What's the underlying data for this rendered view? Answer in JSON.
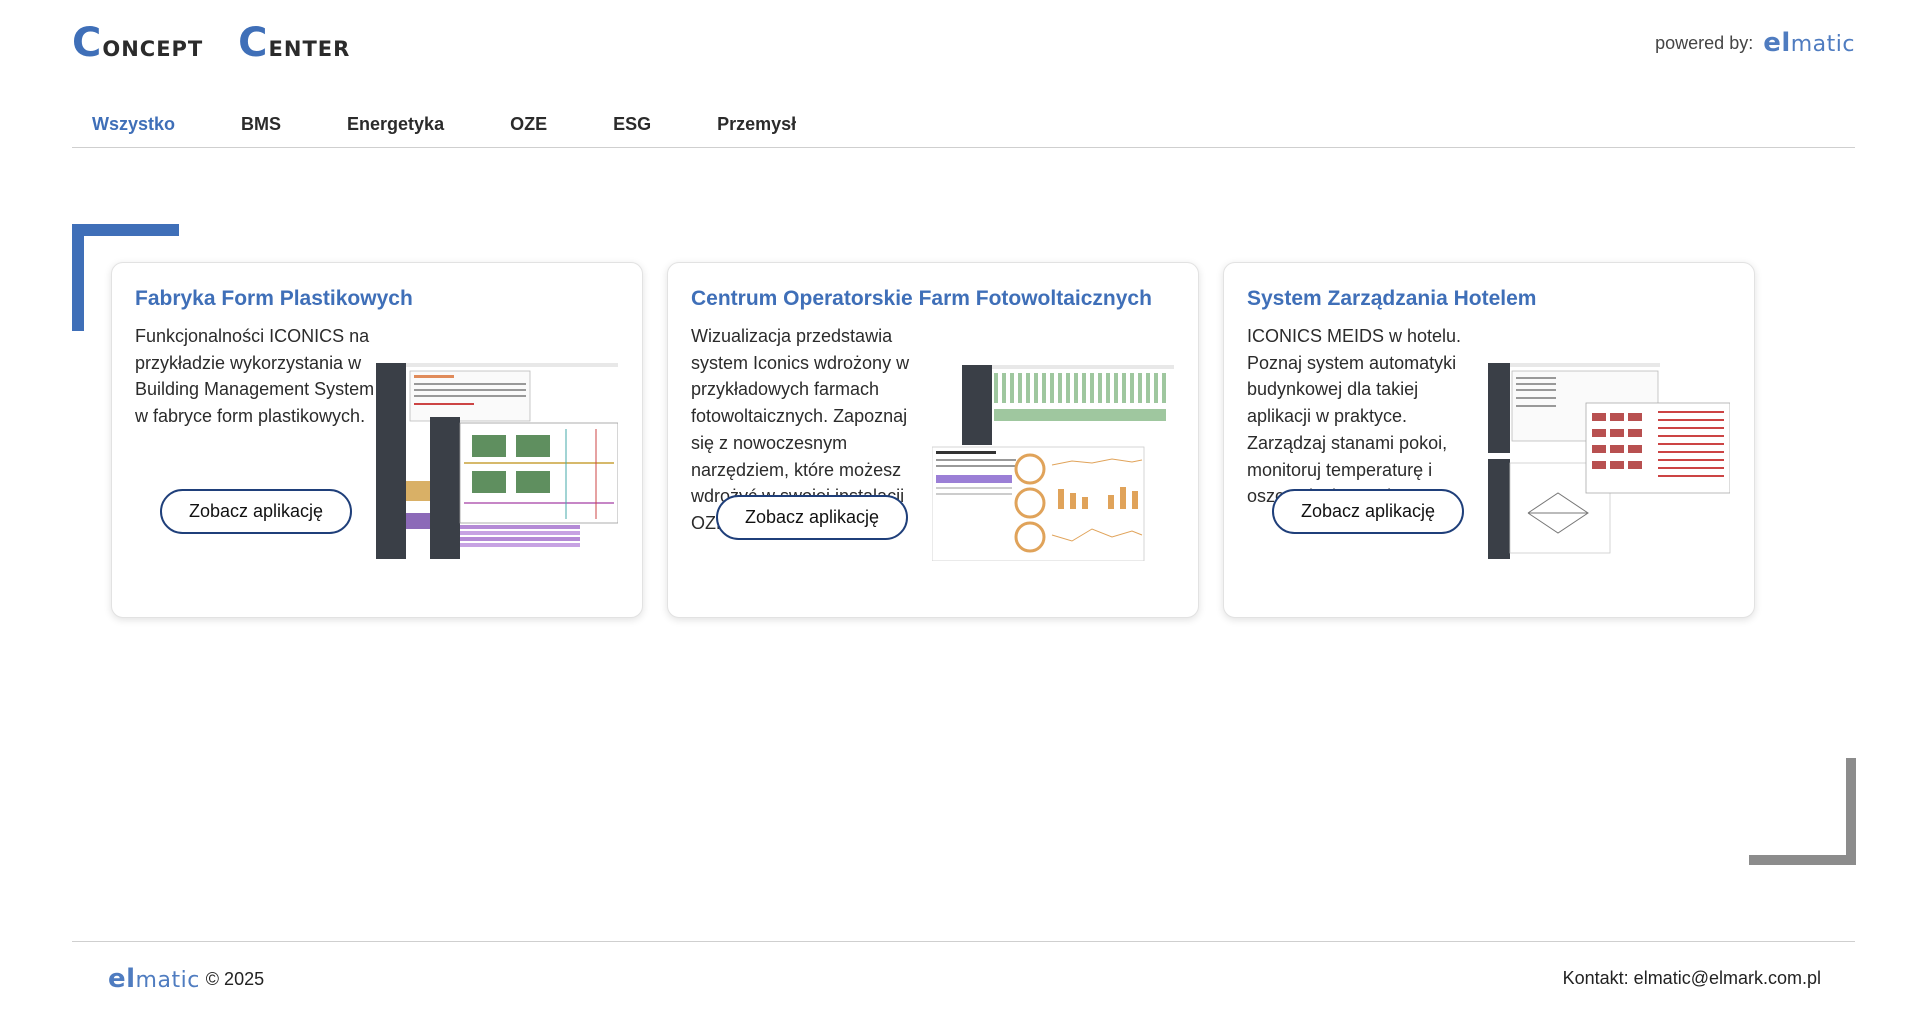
{
  "header": {
    "logo_first_cap": "C",
    "logo_first_rest": "oncept",
    "logo_second_cap": "C",
    "logo_second_rest": "enter",
    "powered_label": "powered by:",
    "brand_e": "el",
    "brand_rest": "matic"
  },
  "nav": {
    "items": [
      {
        "label": "Wszystko"
      },
      {
        "label": "BMS"
      },
      {
        "label": "Energetyka"
      },
      {
        "label": "OZE"
      },
      {
        "label": "ESG"
      },
      {
        "label": "Przemysł"
      }
    ]
  },
  "cards": [
    {
      "title": "Fabryka Form Plastikowych",
      "description": "Funkcjonalności ICONICS na przykładzie wykorzystania w Building Management System w fabryce form plastikowych.",
      "button": "Zobacz aplikację"
    },
    {
      "title": "Centrum Operatorskie Farm Fotowoltaicznych",
      "description": "Wizualizacja przedstawia system Iconics wdrożony w przykładowych farmach fotowoltaicznych. Zapoznaj się z nowoczesnym narzędziem, które możesz wdrożyć w swojej instalacji OZE.",
      "button": "Zobacz aplikację"
    },
    {
      "title": "System Zarządzania Hotelem",
      "description": "ICONICS MEIDS w hotelu. Poznaj system automatyki budynkowej dla takiej aplikacji w praktyce. Zarządzaj stanami pokoi, monitoruj temperaturę i oszczędzaj energię.",
      "button": "Zobacz aplikację"
    }
  ],
  "footer": {
    "brand_e": "el",
    "brand_rest": "matic",
    "copyright": "© 2025",
    "contact": "Kontakt: elmatic@elmark.com.pl"
  },
  "colors": {
    "accent": "#3f6fb8",
    "button_border": "#1f3f7a",
    "corner_gray": "#8c8c8c"
  }
}
